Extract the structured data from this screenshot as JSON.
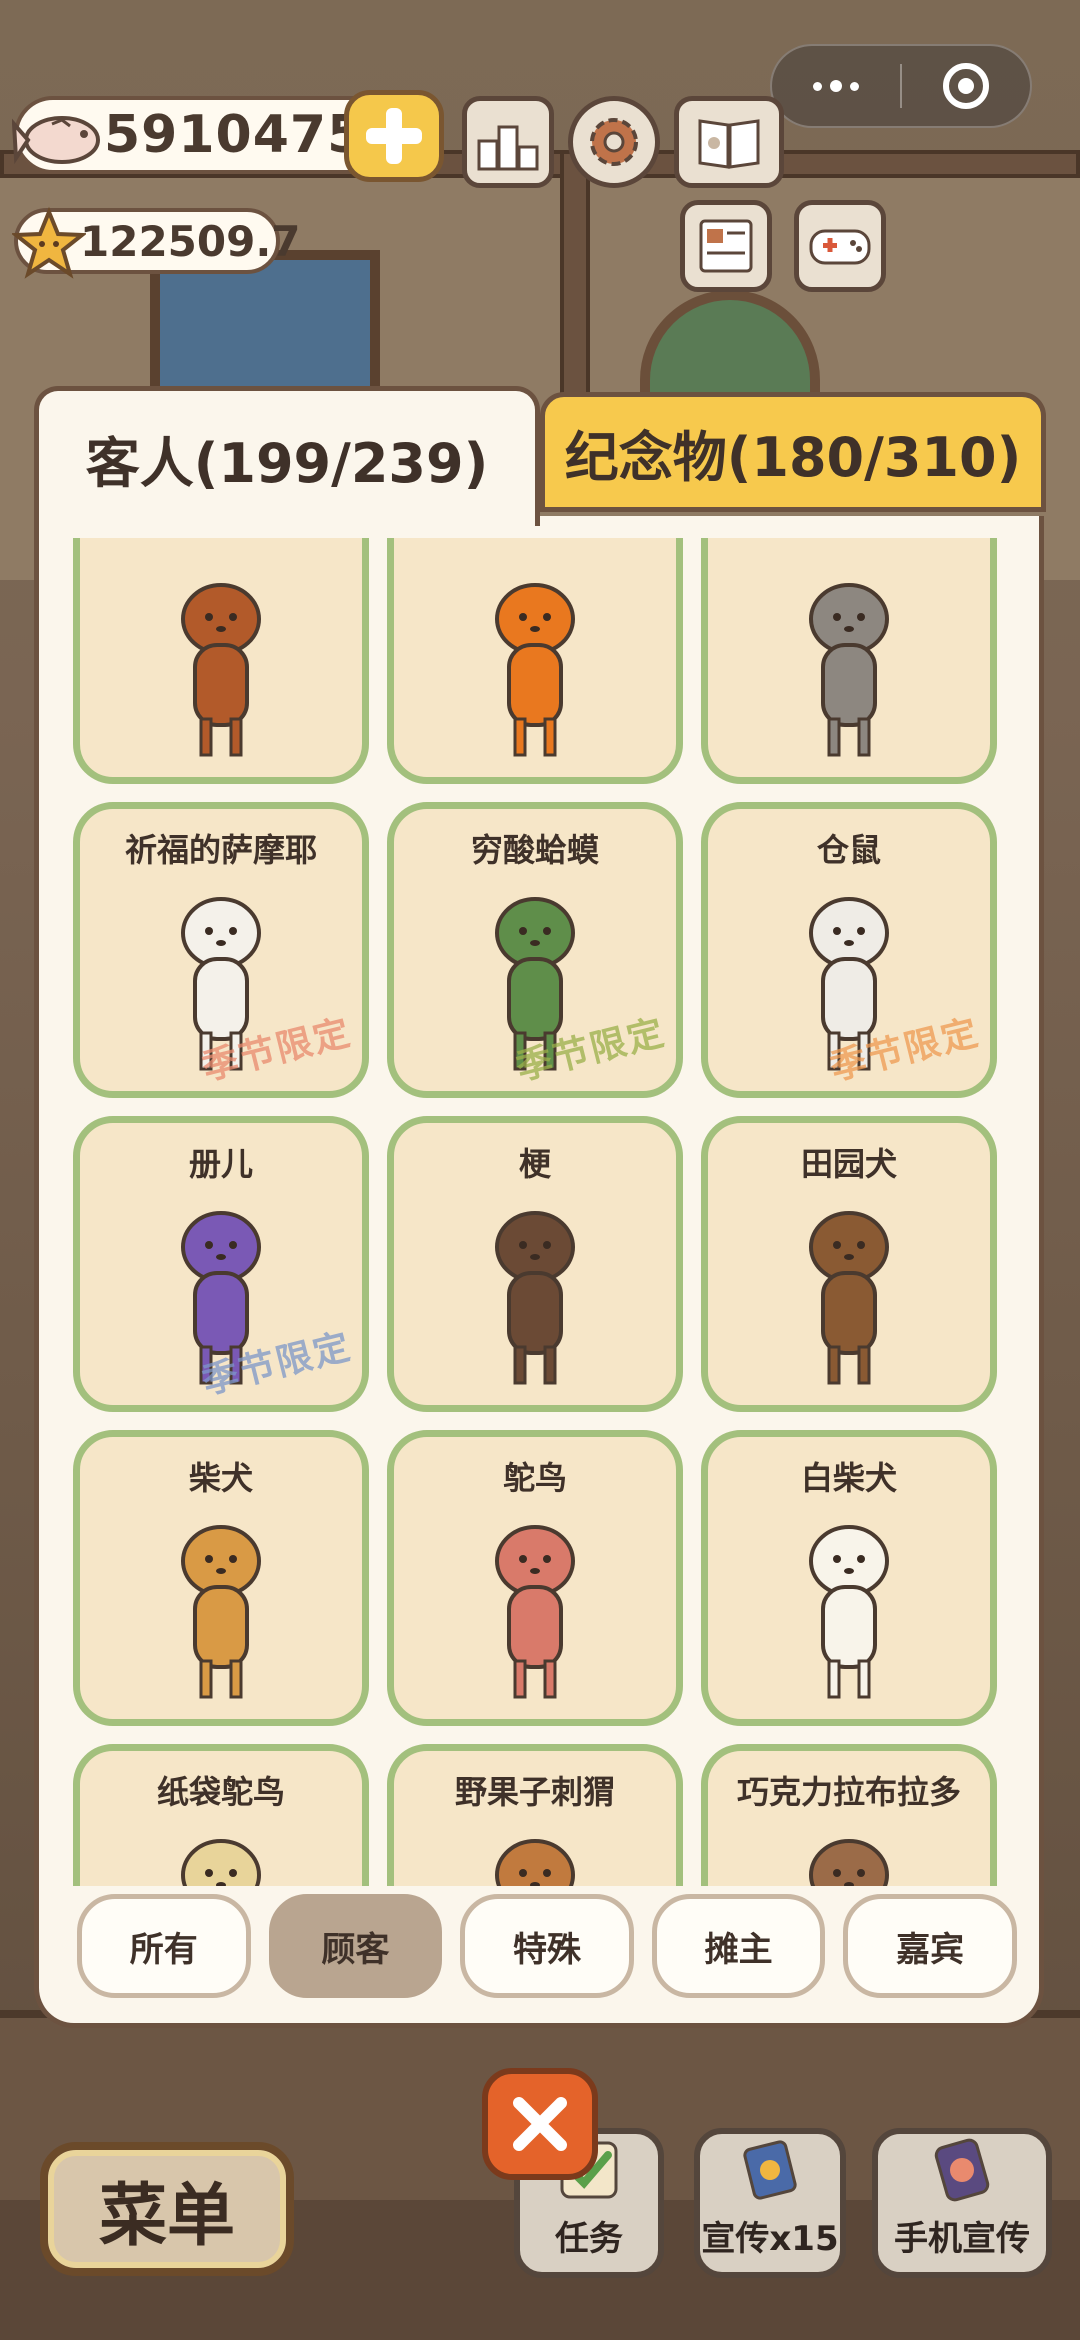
{
  "hud": {
    "fish_amount": "5910475",
    "star_amount": "122509.7",
    "icons": [
      "fish-icon",
      "plus-icon",
      "ranking-icon",
      "gear-icon",
      "book-icon",
      "news-icon",
      "gamepad-icon",
      "more-icon",
      "target-icon"
    ]
  },
  "tabs": {
    "guests": "客人(199/239)",
    "souvenirs": "纪念物(180/310)"
  },
  "cards": [
    {
      "name": "",
      "limited": ""
    },
    {
      "name": "",
      "limited": ""
    },
    {
      "name": "",
      "limited": ""
    },
    {
      "name": "祈福的萨摩耶",
      "limited": "季节限定"
    },
    {
      "name": "穷酸蛤蟆",
      "limited": "季节限定"
    },
    {
      "name": "仓鼠",
      "limited": "季节限定"
    },
    {
      "name": "册儿",
      "limited": "季节限定"
    },
    {
      "name": "梗",
      "limited": ""
    },
    {
      "name": "田园犬",
      "limited": ""
    },
    {
      "name": "柴犬",
      "limited": ""
    },
    {
      "name": "鸵鸟",
      "limited": ""
    },
    {
      "name": "白柴犬",
      "limited": ""
    },
    {
      "name": "纸袋鸵鸟",
      "limited": ""
    },
    {
      "name": "野果子刺猬",
      "limited": ""
    },
    {
      "name": "巧克力拉布拉多",
      "limited": ""
    }
  ],
  "filters": [
    "所有",
    "顾客",
    "特殊",
    "摊主",
    "嘉宾"
  ],
  "active_filter": "顾客",
  "bottom": {
    "menu": "菜单",
    "tasks": "任务",
    "promo": "宣传x15",
    "phone_promo": "手机宣传"
  },
  "colors": {
    "card_border": "#a3c07d",
    "card_bg": "#f6e6c8",
    "tab_active": "#fbf6ec",
    "tab_inactive": "#f7c94d",
    "limited_red": "#e98a6e",
    "limited_green": "#9bb04a",
    "limited_orange": "#ee9a52",
    "limited_blue": "#7d97c9",
    "close_button": "#e4632a"
  }
}
